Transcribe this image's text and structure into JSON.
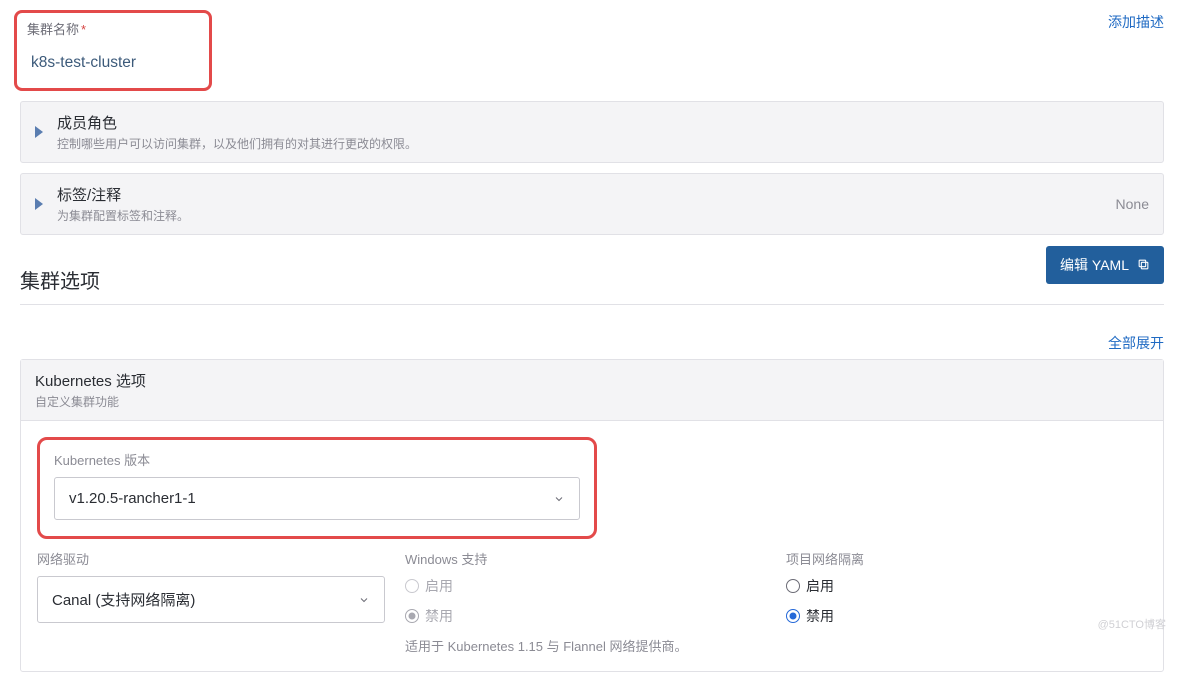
{
  "top": {
    "name_label": "集群名称",
    "name_value": "k8s-test-cluster",
    "add_desc": "添加描述"
  },
  "panels": {
    "members": {
      "title": "成员角色",
      "sub": "控制哪些用户可以访问集群，以及他们拥有的对其进行更改的权限。"
    },
    "labels": {
      "title": "标签/注释",
      "sub": "为集群配置标签和注释。",
      "right": "None"
    }
  },
  "options": {
    "heading": "集群选项",
    "edit_yaml": "编辑 YAML",
    "expand_all": "全部展开"
  },
  "k8s": {
    "title": "Kubernetes 选项",
    "sub": "自定义集群功能",
    "version_label": "Kubernetes 版本",
    "version_value": "v1.20.5-rancher1-1",
    "network": {
      "label": "网络驱动",
      "value": "Canal (支持网络隔离)"
    },
    "windows": {
      "label": "Windows 支持",
      "enable": "启用",
      "disable": "禁用",
      "help": "适用于 Kubernetes 1.15 与 Flannel 网络提供商。"
    },
    "isolation": {
      "label": "项目网络隔离",
      "enable": "启用",
      "disable": "禁用"
    }
  },
  "watermark": "@51CTO博客"
}
